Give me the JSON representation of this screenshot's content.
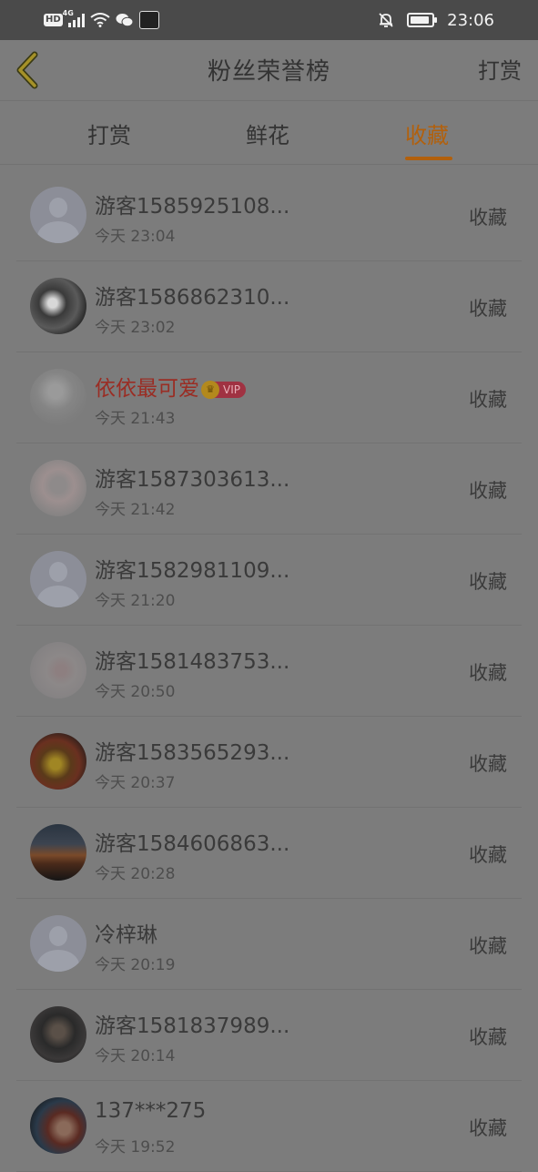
{
  "status_bar": {
    "hd": "HD",
    "network": "4G",
    "time": "23:06",
    "battery_level": 0.9
  },
  "header": {
    "title": "粉丝荣誉榜",
    "right_action": "打赏"
  },
  "tabs": [
    {
      "label": "打赏",
      "active": false
    },
    {
      "label": "鲜花",
      "active": false
    },
    {
      "label": "收藏",
      "active": true
    }
  ],
  "colors": {
    "accent": "#b2600c",
    "vip_name": "#9a2d24",
    "vip_badge": "#a03242"
  },
  "list": [
    {
      "name": "游客1585925108...",
      "time": "今天 23:04",
      "action": "收藏",
      "avatar": "default-avatar-icon",
      "vip": false
    },
    {
      "name": "游客1586862310...",
      "time": "今天 23:02",
      "action": "收藏",
      "avatar": "photo-avatar",
      "vip": false
    },
    {
      "name": "依依最可爱",
      "time": "今天 21:43",
      "action": "收藏",
      "avatar": "photo-avatar",
      "vip": true,
      "vip_label": "VIP"
    },
    {
      "name": "游客1587303613...",
      "time": "今天 21:42",
      "action": "收藏",
      "avatar": "photo-avatar",
      "vip": false
    },
    {
      "name": "游客1582981109...",
      "time": "今天 21:20",
      "action": "收藏",
      "avatar": "default-avatar-icon",
      "vip": false
    },
    {
      "name": "游客1581483753...",
      "time": "今天 20:50",
      "action": "收藏",
      "avatar": "photo-avatar",
      "vip": false
    },
    {
      "name": "游客1583565293...",
      "time": "今天 20:37",
      "action": "收藏",
      "avatar": "photo-avatar",
      "vip": false
    },
    {
      "name": "游客1584606863...",
      "time": "今天 20:28",
      "action": "收藏",
      "avatar": "photo-avatar",
      "vip": false
    },
    {
      "name": "冷梓琳",
      "time": "今天 20:19",
      "action": "收藏",
      "avatar": "default-avatar-icon",
      "vip": false
    },
    {
      "name": "游客1581837989...",
      "time": "今天 20:14",
      "action": "收藏",
      "avatar": "photo-avatar",
      "vip": false
    },
    {
      "name": "137***275",
      "time": "今天 19:52",
      "action": "收藏",
      "avatar": "photo-avatar",
      "vip": false
    }
  ]
}
